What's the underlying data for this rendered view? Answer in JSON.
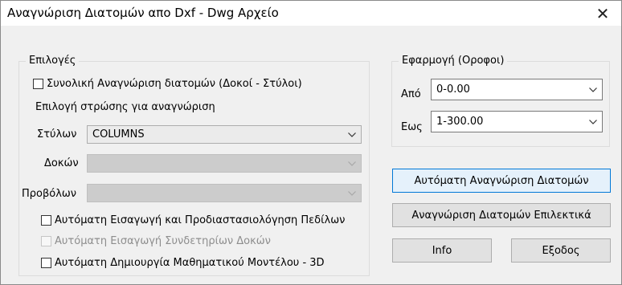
{
  "window": {
    "title": "Αναγνώριση Διατομών απο Dxf - Dwg Αρχείο",
    "close_glyph": "✕"
  },
  "options": {
    "legend": "Επιλογές",
    "total_recognition": {
      "label": "Συνολική Αναγνώριση διατομών (Δοκοί - Στύλοι)",
      "checked": false
    },
    "layer_heading": "Επιλογή στρώσης για αναγνώριση",
    "columns": {
      "label": "Στύλων",
      "value": "COLUMNS"
    },
    "beams": {
      "label": "Δοκών",
      "value": ""
    },
    "projections": {
      "label": "Προβόλων",
      "value": ""
    },
    "auto_footings": {
      "label": "Αυτόματη Εισαγωγή και Προδιαστασιολόγηση Πεδίλων",
      "checked": false
    },
    "auto_beam_connectors": {
      "label": "Αυτόματη Εισαγωγή Συνδετηρίων Δοκών",
      "checked": false,
      "disabled": true
    },
    "auto_model_3d": {
      "label": "Αυτόματη Δημιουργία Μαθηματικού Μοντέλου - 3D",
      "checked": false
    }
  },
  "floors": {
    "legend": "Εφαρμογή (Οροφοι)",
    "from": {
      "label": "Από",
      "value": "0-0.00"
    },
    "to": {
      "label": "Εως",
      "value": "1-300.00"
    }
  },
  "buttons": {
    "auto_recognition": "Αυτόματη Αναγνώριση Διατομών",
    "selective_recognition": "Αναγνώριση Διατομών Επιλεκτικά",
    "info": "Info",
    "exit": "Εξοδος"
  },
  "colors": {
    "window_bg": "#f0f0f0",
    "default_button_border": "#0078d7",
    "default_button_bg": "#e5f1fb",
    "disabled_text": "#8d8d8d"
  },
  "icons": {
    "combo_arrow": "chevron-down-icon",
    "close": "close-icon"
  }
}
